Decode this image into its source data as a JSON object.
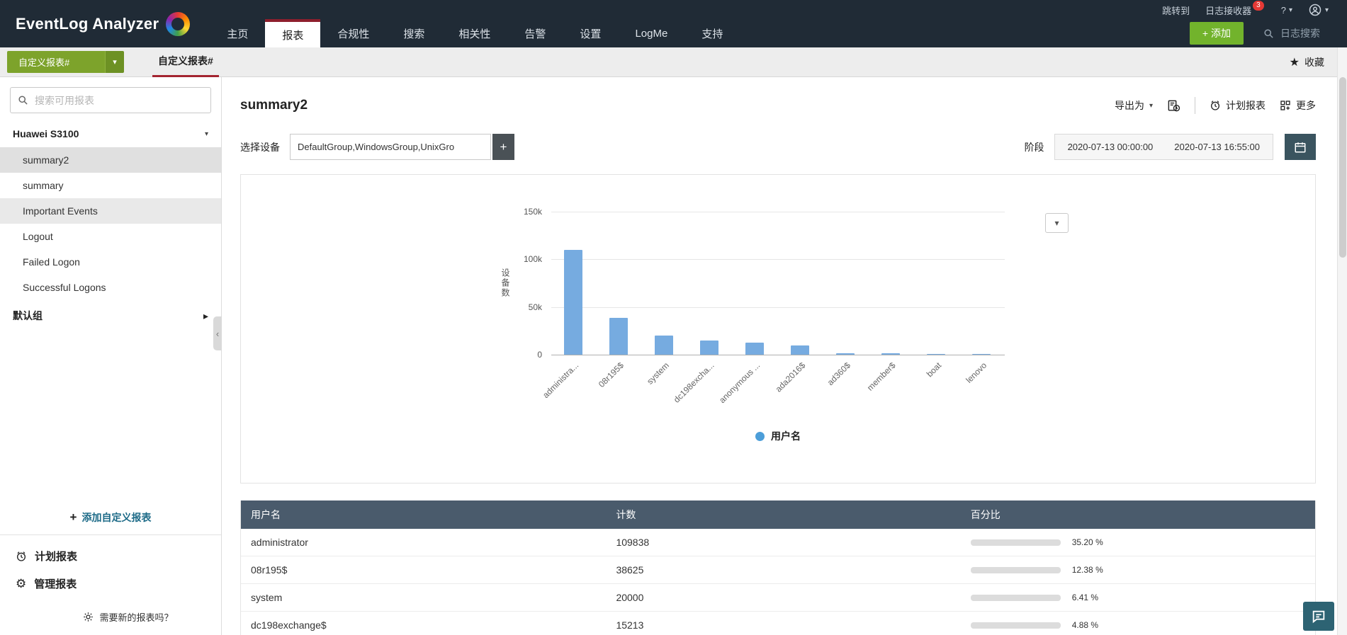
{
  "icons": {
    "star": "★",
    "caret_down": "▾",
    "chevron_down": "˅",
    "arrow_right": "▸",
    "collapse": "‹",
    "gear": "⚙",
    "help": "?",
    "plus": "+",
    "plus_small": "+"
  },
  "topbar": {
    "brand": "EventLog Analyzer",
    "nav": [
      {
        "label": "主页"
      },
      {
        "label": "报表"
      },
      {
        "label": "合规性"
      },
      {
        "label": "搜索"
      },
      {
        "label": "相关性"
      },
      {
        "label": "告警"
      },
      {
        "label": "设置"
      },
      {
        "label": "LogMe"
      },
      {
        "label": "支持"
      }
    ],
    "jump_label": "跳转到",
    "receiver_label": "日志接收器",
    "receiver_badge": "3",
    "add_label": "+ 添加",
    "search_label": "日志搜索"
  },
  "subheader": {
    "dropdown_label": "自定义报表#",
    "tab_label": "自定义报表#",
    "favorite_label": "收藏"
  },
  "sidebar": {
    "search_placeholder": "搜索可用报表",
    "group_label": "Huawei S3100",
    "items": [
      {
        "label": "summary2"
      },
      {
        "label": "summary"
      },
      {
        "label": "Important Events"
      },
      {
        "label": "Logout"
      },
      {
        "label": "Failed Logon"
      },
      {
        "label": "Successful Logons"
      }
    ],
    "default_group_label": "默认组",
    "add_custom_label": "添加自定义报表",
    "scheduled_label": "计划报表",
    "manage_label": "管理报表",
    "need_new_label": "需要新的报表吗？"
  },
  "report": {
    "title": "summary2",
    "export_label": "导出为",
    "schedule_label": "计划报表",
    "more_label": "更多",
    "device_label": "选择设备",
    "device_value": "DefaultGroup,WindowsGroup,UnixGro",
    "period_label": "阶段",
    "date_from": "2020-07-13 00:00:00",
    "date_to": "2020-07-13 16:55:00"
  },
  "chart_data": {
    "type": "bar",
    "title": "",
    "categories": [
      "administra...",
      "08r195$",
      "system",
      "dc198excha...",
      "anonymous ...",
      "ada2016$",
      "ad360$",
      "member$",
      "boat",
      "lenovo"
    ],
    "values": [
      109838,
      38625,
      20000,
      15213,
      12500,
      9300,
      1600,
      1400,
      600,
      450
    ],
    "xlabel": "",
    "ylabel": "设备数",
    "ylim": [
      0,
      150000
    ],
    "yticks": [
      "150k",
      "100k",
      "50k",
      "0"
    ],
    "grid": true,
    "legend": "用户名",
    "legend_position": "bottom",
    "bar_color": "#76abe0",
    "legend_color": "#4c9ed9"
  },
  "table": {
    "headers": [
      "用户名",
      "计数",
      "百分比"
    ],
    "fill_color": "#26a3a0",
    "rows": [
      {
        "name": "administrator",
        "count": "109838",
        "percent": "35.20 %",
        "pct": 35.2
      },
      {
        "name": "08r195$",
        "count": "38625",
        "percent": "12.38 %",
        "pct": 12.38
      },
      {
        "name": "system",
        "count": "20000",
        "percent": "6.41 %",
        "pct": 6.41
      },
      {
        "name": "dc198exchange$",
        "count": "15213",
        "percent": "4.88 %",
        "pct": 4.88
      }
    ]
  }
}
